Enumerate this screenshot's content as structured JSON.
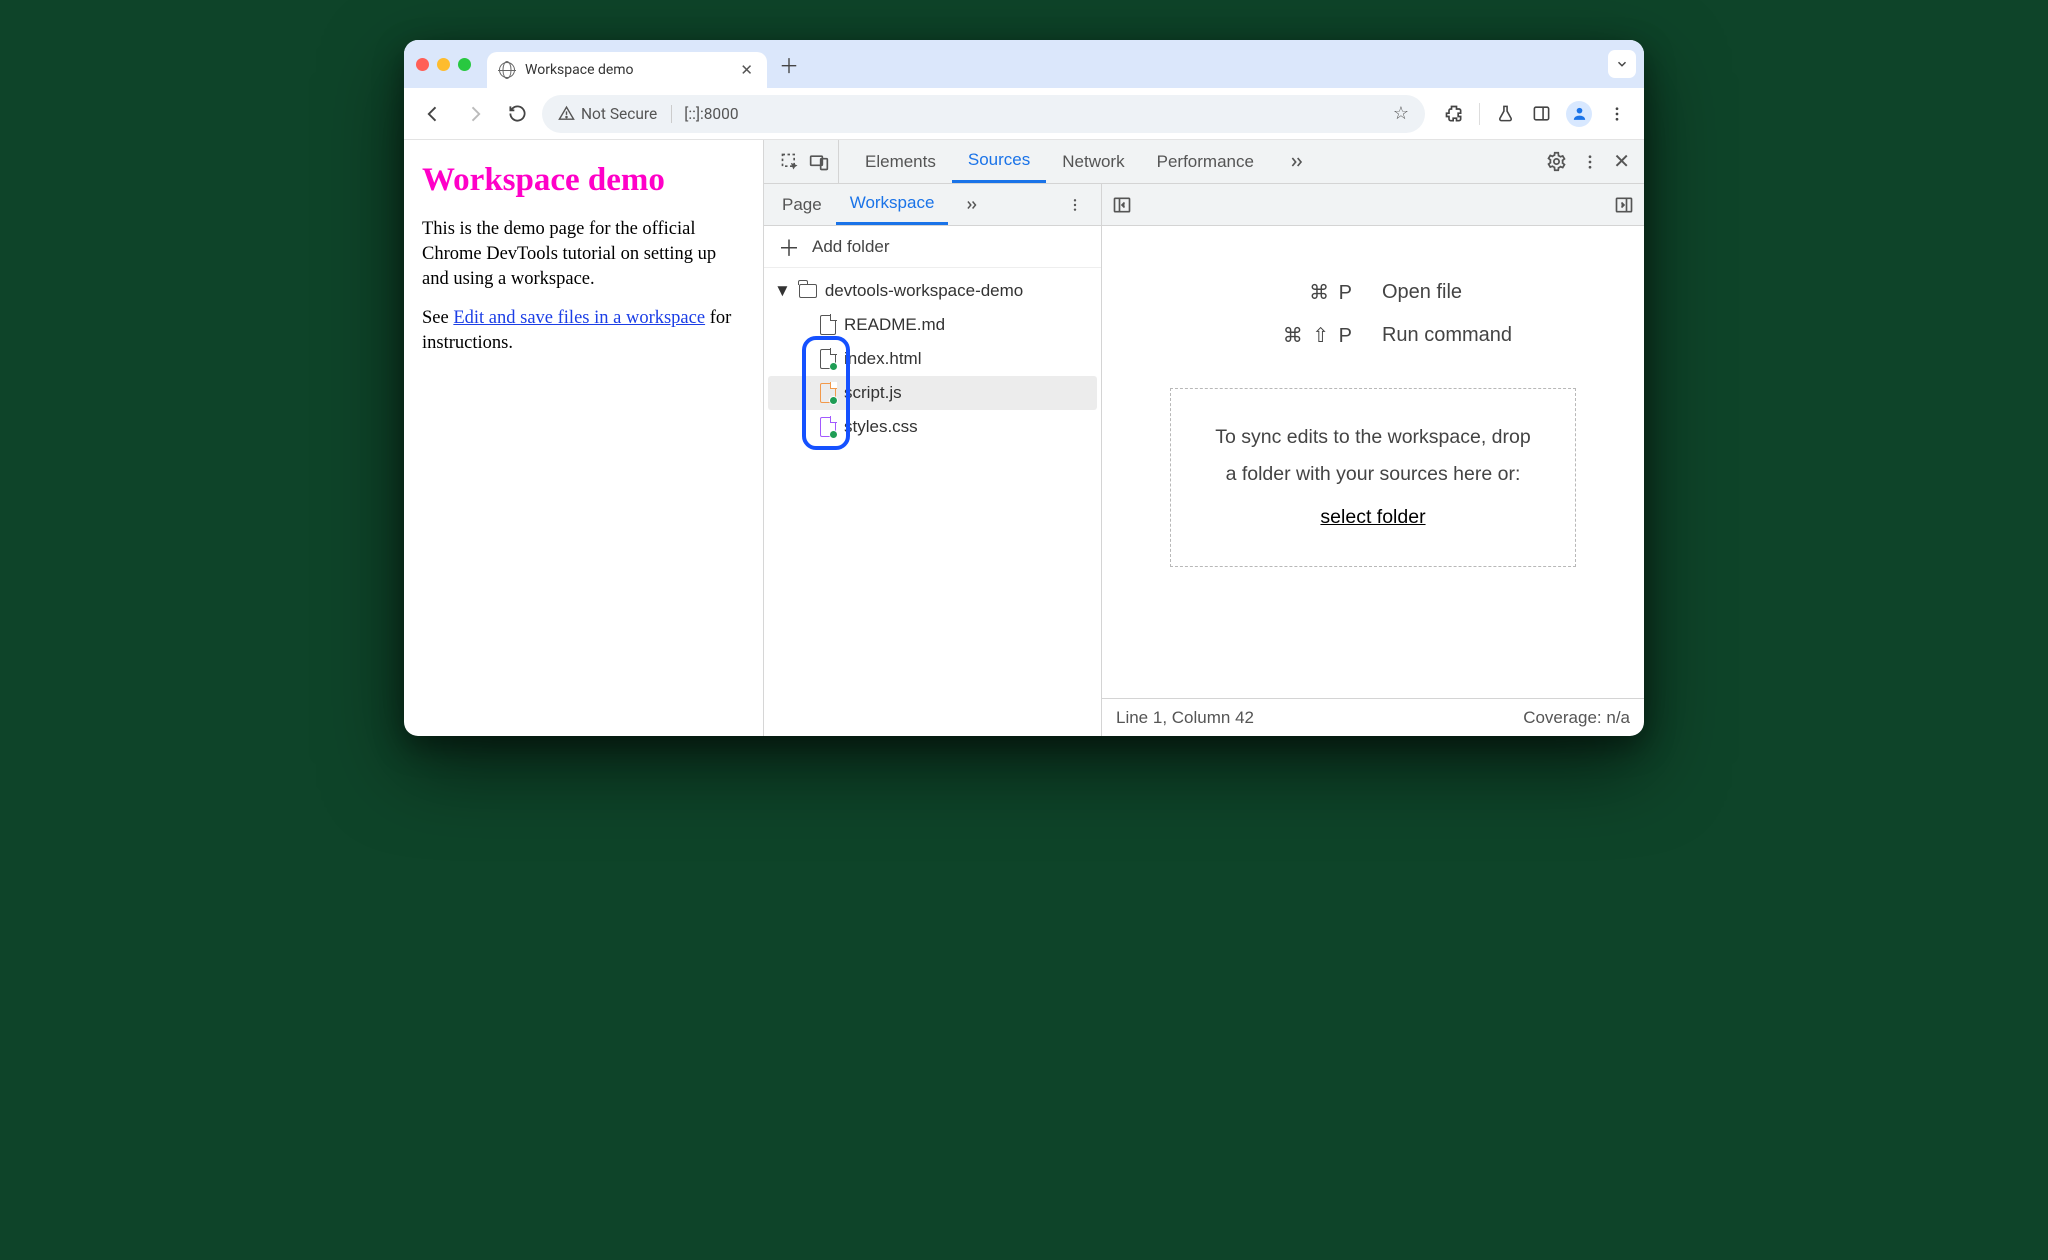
{
  "browser": {
    "tab_title": "Workspace demo",
    "not_secure_label": "Not Secure",
    "url": "[::]:8000"
  },
  "page": {
    "heading": "Workspace demo",
    "paragraph": "This is the demo page for the official Chrome DevTools tutorial on setting up and using a workspace.",
    "see_prefix": "See ",
    "link_text": "Edit and save files in a workspace",
    "see_suffix": " for instructions."
  },
  "devtools": {
    "tabs": {
      "elements": "Elements",
      "sources": "Sources",
      "network": "Network",
      "performance": "Performance"
    },
    "sources": {
      "subtabs": {
        "page": "Page",
        "workspace": "Workspace"
      },
      "add_folder": "Add folder",
      "folder_name": "devtools-workspace-demo",
      "files": {
        "readme": "README.md",
        "index": "index.html",
        "script": "script.js",
        "styles": "styles.css"
      },
      "shortcuts": {
        "open_keys": "⌘ P",
        "open_label": "Open file",
        "run_keys": "⌘ ⇧ P",
        "run_label": "Run command"
      },
      "dropzone": {
        "line1": "To sync edits to the workspace, drop",
        "line2": "a folder with your sources here or:",
        "link": "select folder"
      },
      "status": {
        "pos": "Line 1, Column 42",
        "coverage": "Coverage: n/a"
      }
    }
  }
}
